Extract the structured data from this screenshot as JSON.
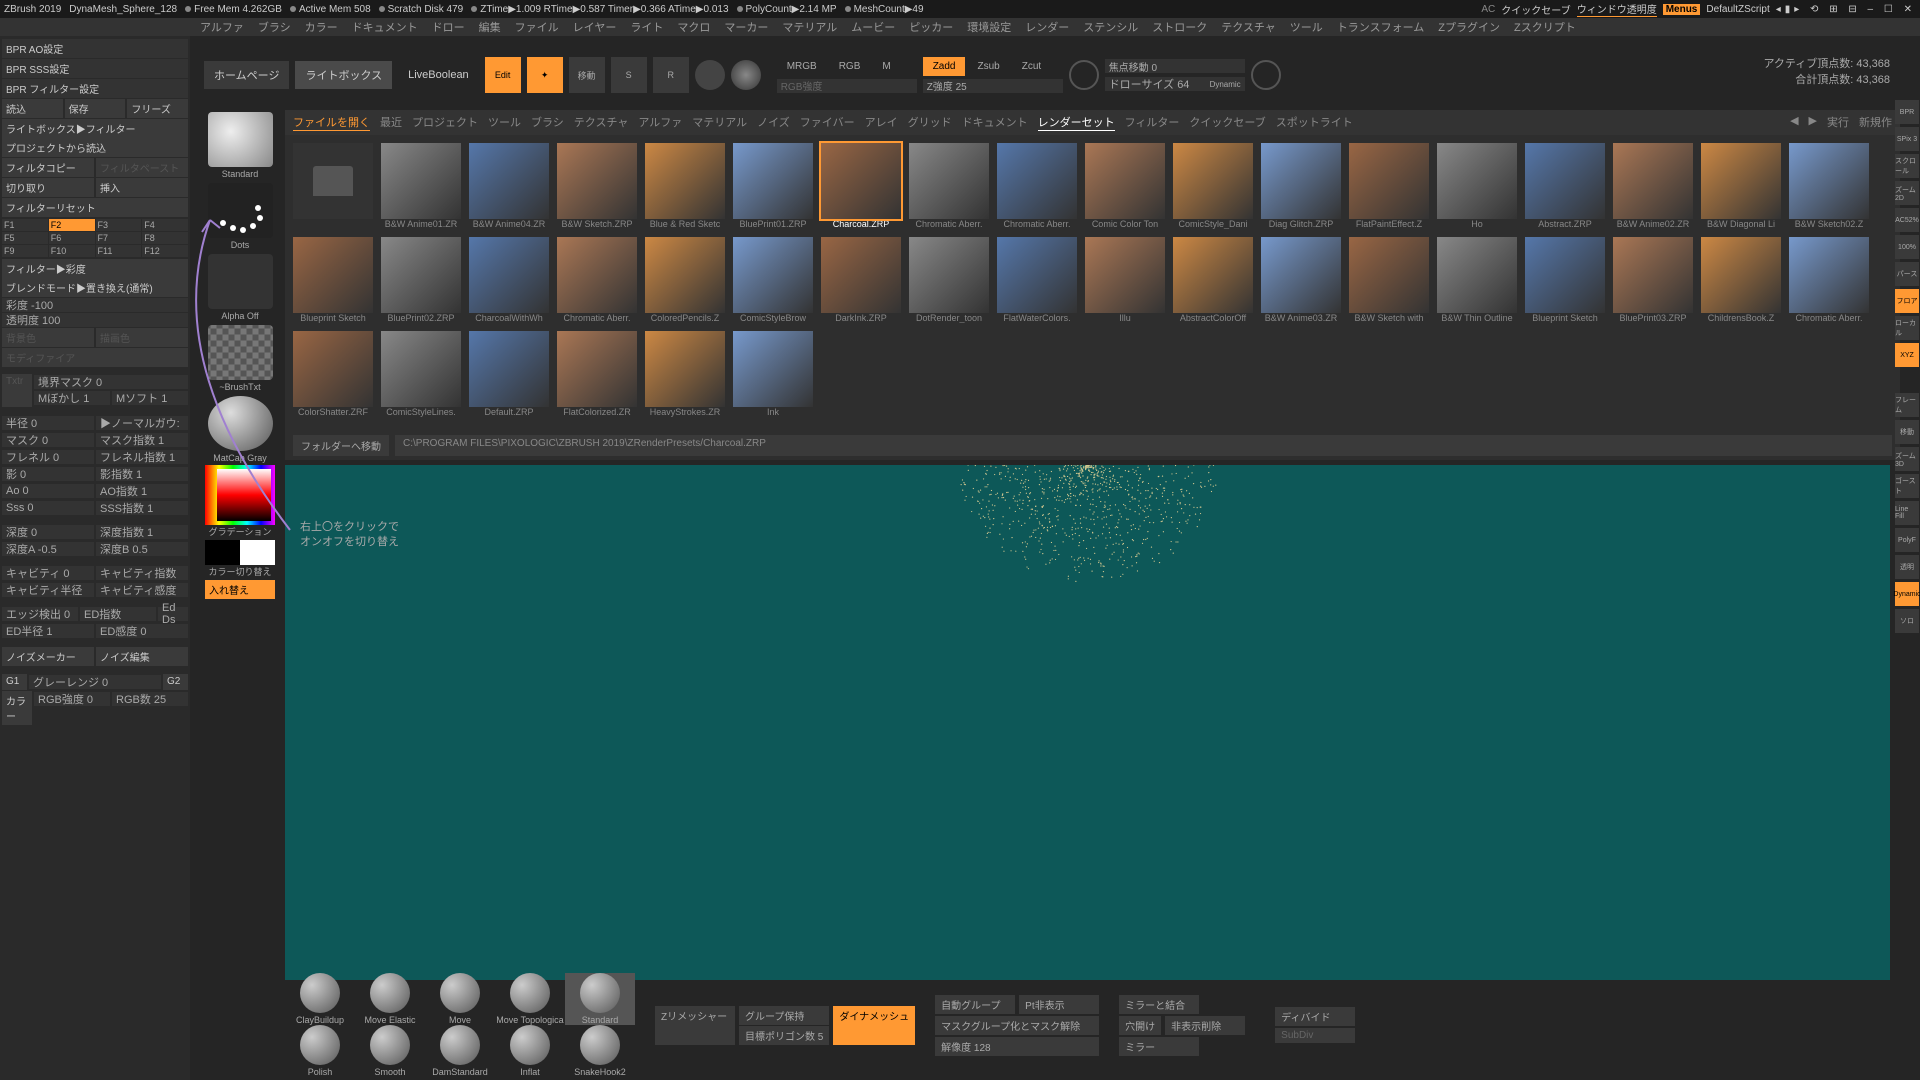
{
  "title": {
    "app": "ZBrush 2019",
    "doc": "DynaMesh_Sphere_128",
    "mem": "Free Mem 4.262GB",
    "amem": "Active Mem 508",
    "scratch": "Scratch Disk 479",
    "ztime": "ZTime▶1.009 RTime▶0.587 Timer▶0.366 ATime▶0.013",
    "poly": "PolyCount▶2.14 MP",
    "mesh": "MeshCount▶49",
    "quicksave": "クイックセーブ",
    "transparency": "ウィンドウ透明度",
    "menus": "Menus",
    "zscript": "DefaultZScript"
  },
  "menu": [
    "アルファ",
    "ブラシ",
    "カラー",
    "ドキュメント",
    "ドロー",
    "編集",
    "ファイル",
    "レイヤー",
    "ライト",
    "マクロ",
    "マーカー",
    "マテリアル",
    "ムービー",
    "ピッカー",
    "環境設定",
    "レンダー",
    "ステンシル",
    "ストローク",
    "テクスチャ",
    "ツール",
    "トランスフォーム",
    "Zプラグイン",
    "Zスクリプト"
  ],
  "toolbar": {
    "home": "ホームページ",
    "lightbox": "ライトボックス",
    "live": "LiveBoolean",
    "edit": "Edit",
    "draw": "ドロー",
    "move": "移動",
    "scale": "スケール",
    "rotate": "回転",
    "mrgb": "MRGB",
    "rgb": "RGB",
    "m": "M",
    "zadd": "Zadd",
    "zsub": "Zsub",
    "zcut": "Zcut",
    "rgbi": "RGB強度",
    "zi": "Z強度 25",
    "focal": "焦点移動 0",
    "drawsize": "ドローサイズ 64",
    "dynamic": "Dynamic"
  },
  "stats": {
    "active": "アクティブ頂点数: 43,368",
    "total": "合計頂点数: 43,368"
  },
  "left": {
    "bpr_ao": "BPR AO設定",
    "bpr_sss": "BPR SSS設定",
    "bpr_filter": "BPR フィルター設定",
    "load": "読込",
    "save": "保存",
    "freeze": "フリーズ",
    "lbfilter": "ライトボックス▶フィルター",
    "proj": "プロジェクトから読込",
    "fcopy": "フィルタコピー",
    "fpaste": "フィルタペースト",
    "replace": "切り取り",
    "insert": "挿入",
    "freset": "フィルターリセット",
    "f": [
      "F1",
      "F2",
      "F3",
      "F4",
      "F5",
      "F6",
      "F7",
      "F8",
      "F9",
      "F10",
      "F11",
      "F12"
    ],
    "filter_sat": "フィルター▶彩度",
    "blend": "ブレンドモード▶置き換え(通常)",
    "sat": "彩度 -100",
    "opac": "透明度 100",
    "bg": "背景色",
    "draw": "描画色",
    "modifier": "モディファイア",
    "boundary": "境界マスク 0",
    "mblur": "Mぼかし 1",
    "msoft": "Mソフト 1",
    "radius": "半径 0",
    "normal": "▶ノーマルガウ:",
    "mask": "マスク 0",
    "maskexp": "マスク指数 1",
    "fresnel": "フレネル 0",
    "fresnelexp": "フレネル指数 1",
    "shadow": "影 0",
    "shadowexp": "影指数 1",
    "ao": "Ao 0",
    "aoexp": "AO指数 1",
    "sss": "Sss 0",
    "sssexp": "SSS指数 1",
    "depth": "深度 0",
    "depthexp": "深度指数 1",
    "deptha": "深度A -0.5",
    "depthb": "深度B 0.5",
    "cavity": "キャビティ 0",
    "cavityexp": "キャビティ指数",
    "cavityr": "キャビティ半径",
    "cavitys": "キャビティ感度",
    "edge": "エッジ検出 0",
    "edexp": "ED指数",
    "edds": "Ed Ds",
    "edr": "ED半径 1",
    "edsen": "ED感度 0",
    "noise": "ノイズメーカー",
    "noiseedit": "ノイズ編集",
    "g1": "G1",
    "gray": "グレーレンジ 0",
    "g2": "G2",
    "col": "カラー",
    "rgbstr": "RGB強度 0",
    "rgbex": "RGB数 25",
    "txtr": "Txtr"
  },
  "side": {
    "standard": "Standard",
    "dots": "Dots",
    "alphaoff": "Alpha Off",
    "brushtxt": "~BrushTxt",
    "matcap": "MatCap Gray",
    "gradient": "グラデーション",
    "colorswitch": "カラー切り替え",
    "swap": "入れ替え"
  },
  "browser": {
    "open": "ファイルを開く",
    "tabs": [
      "最近",
      "プロジェクト",
      "ツール",
      "ブラシ",
      "テクスチャ",
      "アルファ",
      "マテリアル",
      "ノイズ",
      "ファイバー",
      "アレイ",
      "グリッド",
      "ドキュメント",
      "レンダーセット",
      "フィルター",
      "クイックセーブ",
      "スポットライト"
    ],
    "exec": "実行",
    "new": "新規作",
    "folder": "フォルダーへ移動",
    "path": "C:\\PROGRAM FILES\\PIXOLOGIC\\ZBRUSH 2019\\ZRenderPresets/Charcoal.ZRP",
    "items": [
      "B&W Anime01.ZR",
      "B&W Anime04.ZR",
      "B&W Sketch.ZRP",
      "Blue & Red Sketc",
      "BluePrint01.ZRP",
      "Charcoal.ZRP",
      "Chromatic Aberr.",
      "Chromatic Aberr.",
      "Comic Color Ton",
      "ComicStyle_Dani",
      "Diag Glitch.ZRP",
      "FlatPaintEffect.Z",
      "Ho",
      "Abstract.ZRP",
      "B&W Anime02.ZR",
      "B&W Diagonal Li",
      "B&W Sketch02.Z",
      "Blueprint Sketch",
      "BluePrint02.ZRP",
      "CharcoalWithWh",
      "Chromatic Aberr.",
      "ColoredPencils.Z",
      "ComicStyleBrow",
      "DarkInk.ZRP",
      "DotRender_toon",
      "FlatWaterColors.",
      "Illu",
      "AbstractColorOff",
      "B&W Anime03.ZR",
      "B&W Sketch with",
      "B&W Thin Outline",
      "Blueprint Sketch",
      "BluePrint03.ZRP",
      "ChildrensBook.Z",
      "Chromatic Aberr.",
      "ColorShatter.ZRF",
      "ComicStyleLines.",
      "Default.ZRP",
      "FlatColorized.ZR",
      "HeavyStrokes.ZR",
      "Ink"
    ]
  },
  "annotation": {
    "line1": "右上〇をクリックで",
    "line2": "オンオフを切り替え"
  },
  "brushes": [
    "ClayBuildup",
    "Move Elastic",
    "Move",
    "Move Topologica",
    "Standard",
    "Polish",
    "Smooth",
    "DamStandard",
    "Inflat",
    "SnakeHook2"
  ],
  "bottom": {
    "zremesh": "Zリメッシャー",
    "keepgroup": "グループ保持",
    "targetpoly": "目標ポリゴン数 5",
    "dynamesh": "ダイナメッシュ",
    "autogroup": "自動グループ",
    "pthide": "Pt非表示",
    "mergemirror": "ミラーと結合",
    "maskgroup": "マスクグループ化とマスク解除",
    "openhole": "穴開け",
    "delvis": "非表示削除",
    "res": "解像度 128",
    "mirror": "ミラー",
    "subdiv": "SubDiv",
    "divide": "ディバイド"
  },
  "rail": [
    "BPR",
    "SPix 3",
    "スクロール",
    "ズーム2D",
    "AC52%",
    "100%",
    "パース",
    "フロア",
    "ローカル",
    "フレーム",
    "移動",
    "ズーム3D",
    "ゴースト",
    "Line Fill",
    "PolyF",
    "透明",
    "Dynamic",
    "ソロ",
    "XYZ"
  ]
}
